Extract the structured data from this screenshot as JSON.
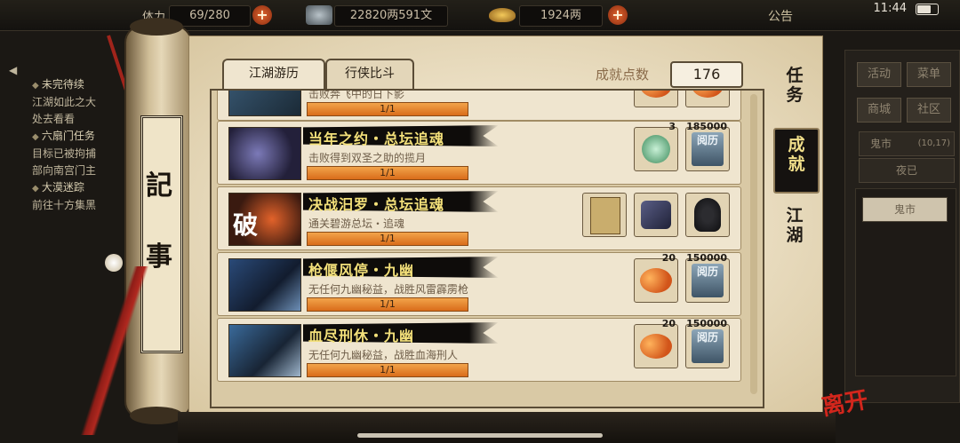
{
  "status": {
    "time": "11:44"
  },
  "topbar": {
    "stat_label": "体力",
    "stamina": "69/280",
    "money": "22820两591文",
    "gold": "1924两",
    "notice": "公告"
  },
  "left_log": {
    "lines": [
      {
        "text": "未完待续",
        "head": true
      },
      {
        "text": "江湖如此之大",
        "head": false
      },
      {
        "text": "处去看看",
        "head": false
      },
      {
        "text": "六扇门任务",
        "head": true
      },
      {
        "text": "目标已被拘捕",
        "head": false
      },
      {
        "text": "部向南宫门主",
        "head": false
      },
      {
        "text": "大漠迷踪",
        "head": true
      },
      {
        "text": "前往十方集黑",
        "head": false
      }
    ]
  },
  "scroll": {
    "chars": [
      "記",
      "事"
    ]
  },
  "tabs": [
    "江湖游历",
    "行侠比斗"
  ],
  "score": {
    "label": "成就点数",
    "value": "176"
  },
  "achievements": [
    {
      "title": "",
      "desc": "击败奔飞中的日下影",
      "progress": "1/1",
      "progress_fraction": 1,
      "thumb": "partial",
      "rewards": [
        {
          "icon": "orange-item-icon",
          "count": ""
        },
        {
          "icon": "orange-item-icon",
          "count": ""
        }
      ]
    },
    {
      "title": "当年之约・总坛追魂",
      "desc": "击败得到双圣之助的揽月",
      "progress": "1/1",
      "progress_fraction": 1,
      "thumb": "jade",
      "rewards": [
        {
          "icon": "jade-gem-icon",
          "count": "3"
        },
        {
          "icon": "yueli-tome-icon",
          "count": "185000",
          "label": "阅历"
        }
      ]
    },
    {
      "title": "决战汨罗・总坛追魂",
      "desc": "通关碧游总坛・追魂",
      "progress": "1/1",
      "progress_fraction": 1,
      "thumb": "broken",
      "badge": "破",
      "rewards": [
        {
          "icon": "manual-book-icon",
          "count": ""
        },
        {
          "icon": "armor-icon",
          "count": ""
        },
        {
          "icon": "hood-icon",
          "count": ""
        }
      ]
    },
    {
      "title": "枪偃风停・九幽",
      "desc": "无任何九幽秘益，战胜风雷霹雳枪",
      "progress": "1/1",
      "progress_fraction": 1,
      "thumb": "blue",
      "rewards": [
        {
          "icon": "peach-icon",
          "count": "20"
        },
        {
          "icon": "yueli-tome-icon",
          "count": "150000",
          "label": "阅历"
        }
      ]
    },
    {
      "title": "血尽刑休・九幽",
      "desc": "无任何九幽秘益，战胜血海刑人",
      "progress": "1/1",
      "progress_fraction": 1,
      "thumb": "blue2",
      "rewards": [
        {
          "icon": "peach-icon",
          "count": "20"
        },
        {
          "icon": "yueli-tome-icon",
          "count": "150000",
          "label": "阅历"
        }
      ]
    }
  ],
  "right_nav": [
    "任务",
    "成就",
    "江湖"
  ],
  "right_nav_active": 1,
  "side_panel": {
    "buttons": [
      "活动",
      "菜单",
      "商城",
      "社区"
    ],
    "location": "鬼市",
    "coords": "(10,17)",
    "sub": "夜已",
    "entry": "鬼市"
  },
  "leave_label": "离开",
  "colors": {
    "title_yellow": "#f3e07a",
    "progress_orange": "#e3822a",
    "paper": "#e9dcc0"
  }
}
